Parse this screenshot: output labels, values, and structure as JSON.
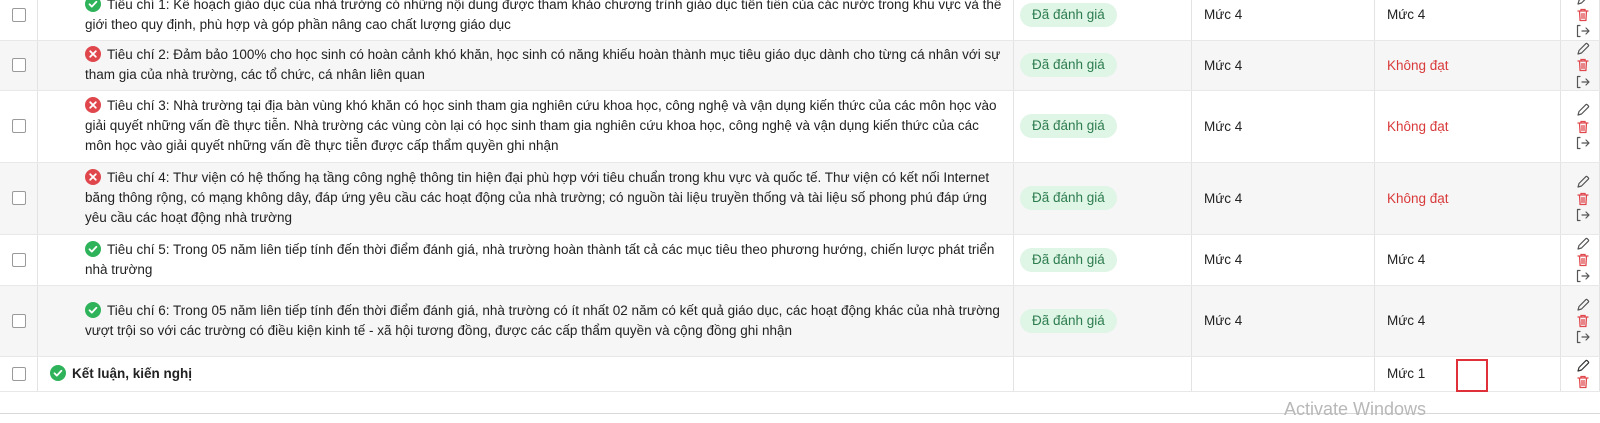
{
  "rows": [
    {
      "status_icon": "check-circle-icon",
      "text": "Tiêu chí 1: Kế hoạch giáo dục của nhà trường có những nội dung được tham khảo chương trình giáo dục tiên tiến của các nước trong khu vực và thế giới theo quy định, phù hợp và góp phần nâng cao chất lượng giáo dục",
      "badge": "Đã đánh giá",
      "level_self": "Mức 4",
      "level_result": "Mức 4"
    },
    {
      "status_icon": "x-circle-icon",
      "text": "Tiêu chí 2: Đảm bảo 100% cho học sinh có hoàn cảnh khó khăn, học sinh có năng khiếu hoàn thành mục tiêu giáo dục dành cho từng cá nhân với sự tham gia của nhà trường, các tổ chức, cá nhân liên quan",
      "badge": "Đã đánh giá",
      "level_self": "Mức 4",
      "level_result": "Không đạt"
    },
    {
      "status_icon": "x-circle-icon",
      "text": "Tiêu chí 3: Nhà trường tại địa bàn vùng khó khăn có học sinh tham gia nghiên cứu khoa học, công nghệ và vận dụng kiến thức của các môn học vào giải quyết những vấn đề thực tiễn. Nhà trường các vùng còn lại có học sinh tham gia nghiên cứu khoa học, công nghệ và vận dụng kiến thức của các môn học vào giải quyết những vấn đề thực tiễn được cấp thẩm quyền ghi nhận",
      "badge": "Đã đánh giá",
      "level_self": "Mức 4",
      "level_result": "Không đạt"
    },
    {
      "status_icon": "x-circle-icon",
      "text": "Tiêu chí 4: Thư viện có hệ thống hạ tầng công nghệ thông tin hiện đại phù hợp với tiêu chuẩn trong khu vực và quốc tế. Thư viện có kết nối Internet băng thông rộng, có mạng không dây, đáp ứng yêu cầu các hoạt động của nhà trường; có nguồn tài liệu truyền thống và tài liệu số phong phú đáp ứng yêu cầu các hoạt động nhà trường",
      "badge": "Đã đánh giá",
      "level_self": "Mức 4",
      "level_result": "Không đạt"
    },
    {
      "status_icon": "check-circle-icon",
      "text": "Tiêu chí 5: Trong 05 năm liên tiếp tính đến thời điểm đánh giá, nhà trường hoàn thành tất cả các mục tiêu theo phương hướng, chiến lược phát triển nhà trường",
      "badge": "Đã đánh giá",
      "level_self": "Mức 4",
      "level_result": "Mức 4"
    },
    {
      "status_icon": "check-circle-icon",
      "text": "Tiêu chí 6: Trong 05 năm liên tiếp tính đến thời điểm đánh giá, nhà trường có ít nhất 02 năm có kết quả giáo dục, các hoạt động khác của nhà trường vượt trội so với các trường có điều kiện kinh tế - xã hội tương đồng, được các cấp thẩm quyền và cộng đồng ghi nhận",
      "badge": "Đã đánh giá",
      "level_self": "Mức 4",
      "level_result": "Mức 4"
    }
  ],
  "conclusion": {
    "label": "Kết luận, kiến nghị",
    "level_result": "Mức 1"
  },
  "colors": {
    "check": "#2fb35a",
    "cross": "#e0474c",
    "fail_text": "#d93a3a",
    "badge_bg": "#dff5e6",
    "badge_text": "#2e7d4f",
    "trash": "#e0474c"
  },
  "watermark": "Activate Windows"
}
